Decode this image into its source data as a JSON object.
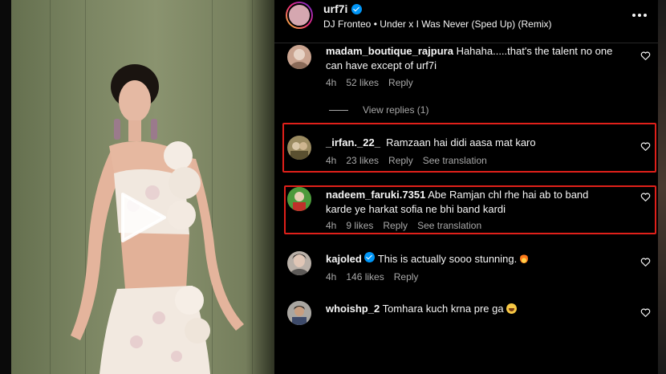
{
  "post": {
    "username": "urf7i",
    "audio": "DJ Fronteo • Under x I Was Never (Sped Up) (Remix)"
  },
  "comments": [
    {
      "username": "madam_boutique_rajpura",
      "text": "Hahaha.....that's the talent no one can have except of urf7i",
      "time": "4h",
      "likes": "52 likes",
      "reply": "Reply",
      "avatar_color": "#c9a38f"
    },
    {
      "username": "_irfan._22_",
      "text": "Ramzaan hai didi aasa mat karo",
      "time": "4h",
      "likes": "23 likes",
      "reply": "Reply",
      "translate": "See translation",
      "avatar_color": "#9a8a60"
    },
    {
      "username": "nadeem_faruki.7351",
      "text": "Abe Ramjan chl rhe hai ab to band karde ye harkat sofia ne bhi band kardi",
      "time": "4h",
      "likes": "9 likes",
      "reply": "Reply",
      "translate": "See translation",
      "avatar_color": "#3d8a3a"
    },
    {
      "username": "kajoled",
      "text": "This is actually sooo stunning.",
      "time": "4h",
      "likes": "146 likes",
      "reply": "Reply",
      "avatar_color": "#b9b0a8"
    },
    {
      "username": "whoishp_2",
      "text": "Tomhara kuch krna pre ga",
      "avatar_color": "#7b7a80"
    }
  ],
  "view_replies": "View replies (1)",
  "colors": {
    "highlight": "#e0201a",
    "muted_text": "#a8a8a8",
    "verified": "#0095f6",
    "background": "#000000"
  }
}
